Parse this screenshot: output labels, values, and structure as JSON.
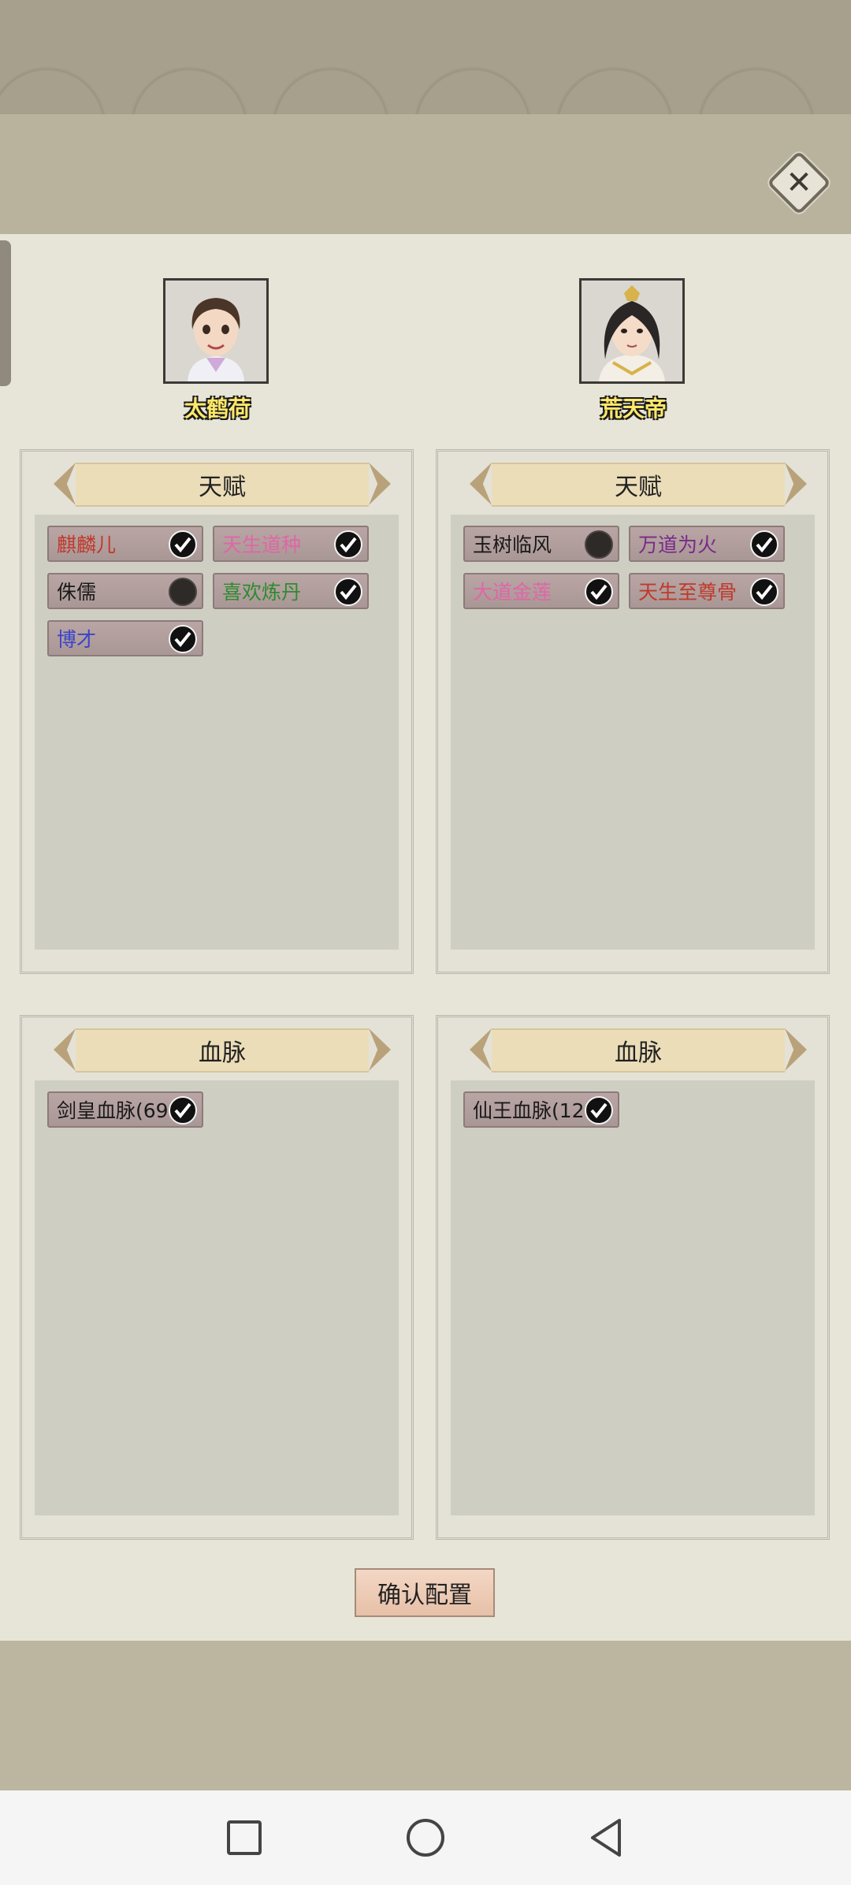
{
  "characters": [
    {
      "name": "太鹤荷",
      "talent_title": "天赋",
      "talents": [
        {
          "label": "麒麟儿",
          "color": "#c0392b",
          "checked": true
        },
        {
          "label": "天生道种",
          "color": "#e066a6",
          "checked": true
        },
        {
          "label": "侏儒",
          "color": "#1a1a1a",
          "checked": false
        },
        {
          "label": "喜欢炼丹",
          "color": "#2e8b2e",
          "checked": true
        },
        {
          "label": "博才",
          "color": "#3b45c9",
          "checked": true
        }
      ],
      "bloodline_title": "血脉",
      "bloodlines": [
        {
          "label": "剑皇血脉(69",
          "color": "#1a1a1a",
          "checked": true
        }
      ]
    },
    {
      "name": "荒天帝",
      "talent_title": "天赋",
      "talents": [
        {
          "label": "玉树临风",
          "color": "#1a1a1a",
          "checked": false
        },
        {
          "label": "万道为火",
          "color": "#7a2a8a",
          "checked": true
        },
        {
          "label": "大道金莲",
          "color": "#e066a6",
          "checked": true
        },
        {
          "label": "天生至尊骨",
          "color": "#c0392b",
          "checked": true
        }
      ],
      "bloodline_title": "血脉",
      "bloodlines": [
        {
          "label": "仙王血脉(12",
          "color": "#1a1a1a",
          "checked": true
        }
      ]
    }
  ],
  "confirm_label": "确认配置",
  "icons": {
    "close": "close-icon",
    "check": "check-icon",
    "nav_recent": "square-icon",
    "nav_home": "circle-icon",
    "nav_back": "triangle-back-icon"
  }
}
